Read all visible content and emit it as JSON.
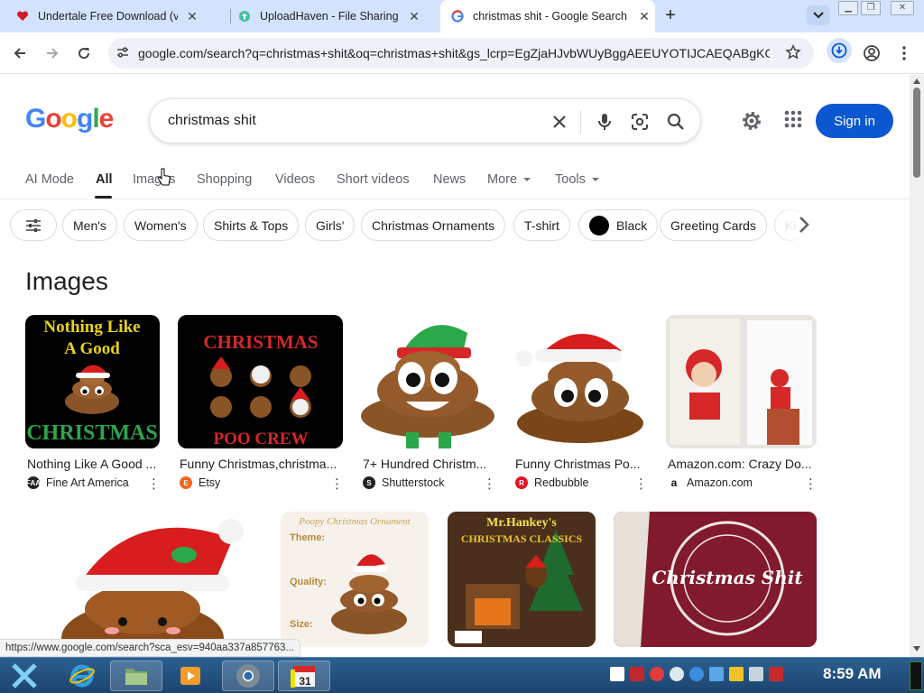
{
  "browser": {
    "tabs": [
      {
        "title": "Undertale Free Download (v1.08",
        "favicon": "undertale-heart-icon",
        "active": false
      },
      {
        "title": "UploadHaven - File Sharing Ma",
        "favicon": "uploadhaven-icon",
        "active": false
      },
      {
        "title": "christmas shit - Google Search",
        "favicon": "google-g-icon",
        "active": true
      }
    ],
    "new_tab": "+",
    "url": "google.com/search?q=christmas+shit&oq=christmas+shit&gs_lcrp=EgZjaHJvbWUyBggAEEUYOTIJCAEQABgKGI...",
    "status_url": "https://www.google.com/search?sca_esv=940aa337a857763..."
  },
  "google": {
    "logo": "Google",
    "query": "christmas shit",
    "sign_in": "Sign in",
    "nav": [
      {
        "label": "AI Mode",
        "active": false
      },
      {
        "label": "All",
        "active": true
      },
      {
        "label": "Images",
        "active": false
      },
      {
        "label": "Shopping",
        "active": false
      },
      {
        "label": "Videos",
        "active": false
      },
      {
        "label": "Short videos",
        "active": false
      },
      {
        "label": "News",
        "active": false
      },
      {
        "label": "More",
        "active": false
      },
      {
        "label": "Tools",
        "active": false
      }
    ],
    "chips": [
      "Men's",
      "Women's",
      "Shirts & Tops",
      "Girls'",
      "Christmas Ornaments",
      "T-shirt",
      "Black",
      "Greeting Cards",
      "Ki"
    ],
    "images_heading": "Images",
    "results": [
      {
        "caption": "Nothing Like A Good ...",
        "source": "Fine Art America"
      },
      {
        "caption": "Funny Christmas,christma...",
        "source": "Etsy"
      },
      {
        "caption": "7+ Hundred Christm...",
        "source": "Shutterstock"
      },
      {
        "caption": "Funny Christmas Po...",
        "source": "Redbubble"
      },
      {
        "caption": "Amazon.com: Crazy Do...",
        "source": "Amazon.com"
      }
    ],
    "image_texts": {
      "t1_top": "Nothing Like",
      "t1_mid": "A Good",
      "t1_bot": "CHRISTMAS",
      "t2_top": "CHRISTMAS",
      "t2_bot": "POO CREW",
      "t7_title": "Poopy Christmas Ornament",
      "t7_theme": "Theme:",
      "t7_quality": "Quality:",
      "t7_size": "Size:",
      "t8_title": "Mr.Hankey's",
      "t8_sub": "CHRISTMAS CLASSICS",
      "t9_text": "Christmas Shit"
    }
  },
  "taskbar": {
    "clock": "8:59 AM"
  },
  "colors": {
    "tabbar": "#d3e3fd",
    "signin": "#0b57d0",
    "taskbar": "#1c4570"
  }
}
